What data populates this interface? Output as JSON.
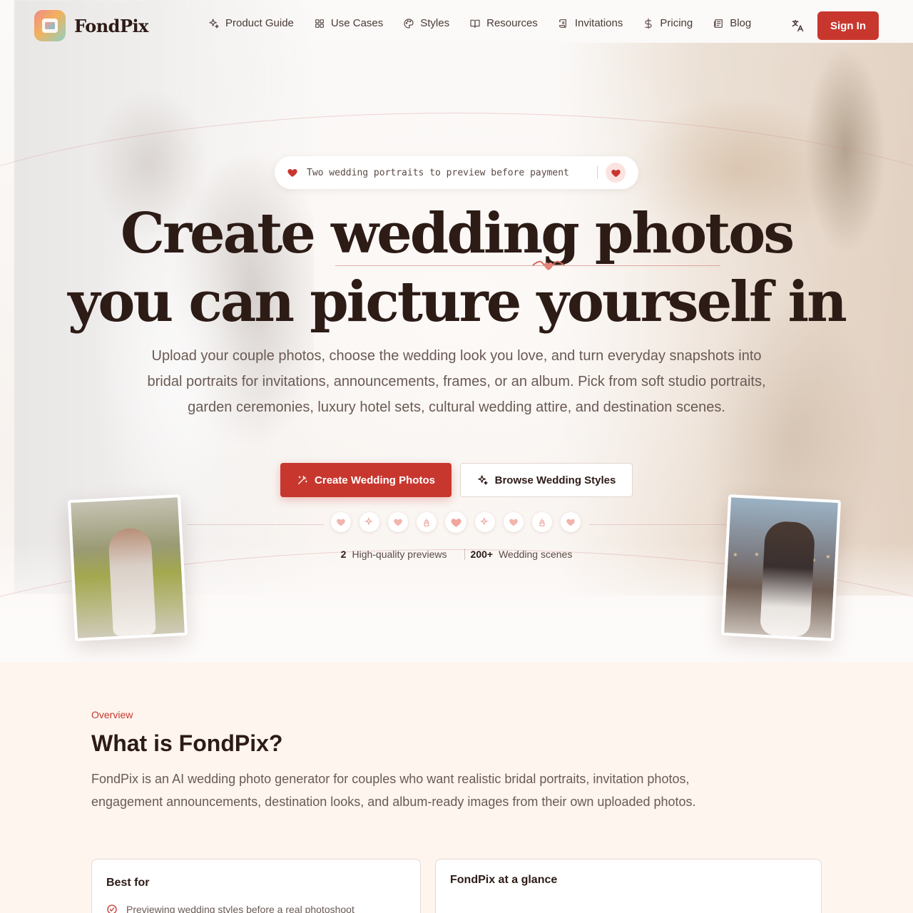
{
  "brand": {
    "name": "FondPix"
  },
  "nav": {
    "items": [
      {
        "label": "Product Guide",
        "icon": "sparkles-icon"
      },
      {
        "label": "Use Cases",
        "icon": "grid-icon"
      },
      {
        "label": "Styles",
        "icon": "palette-icon"
      },
      {
        "label": "Resources",
        "icon": "book-open-icon"
      },
      {
        "label": "Invitations",
        "icon": "scroll-icon"
      },
      {
        "label": "Pricing",
        "icon": "dollar-icon"
      },
      {
        "label": "Blog",
        "icon": "newspaper-icon"
      }
    ],
    "language_icon": "translate-icon",
    "sign_in": "Sign In"
  },
  "hero": {
    "pill_text": "Two wedding portraits to preview before payment",
    "headline_line1": "Create wedding photos",
    "headline_line2": "you can picture yourself in",
    "subtext": "Upload your couple photos, choose the wedding look you love, and turn everyday snapshots into bridal portraits for invitations, announcements, frames, or an album. Pick from soft studio portraits, garden ceremonies, luxury hotel sets, cultural wedding attire, and destination scenes.",
    "cta_primary": "Create Wedding Photos",
    "cta_secondary": "Browse Wedding Styles",
    "icon_row": [
      "heart-icon",
      "sparkles-icon",
      "heart-icon",
      "cake-icon",
      "heart-icon",
      "sparkles-icon",
      "heart-icon",
      "cake-icon",
      "heart-icon"
    ],
    "stats": [
      {
        "value": "2",
        "label": "High-quality previews"
      },
      {
        "value": "200+",
        "label": "Wedding scenes"
      }
    ]
  },
  "overview": {
    "eyebrow": "Overview",
    "title": "What is FondPix?",
    "text": "FondPix is an AI wedding photo generator for couples who want realistic bridal portraits, invitation photos, engagement announcements, destination looks, and album-ready images from their own uploaded photos.",
    "best_for_title": "Best for",
    "best_for_items": [
      "Previewing wedding styles before a real photoshoot"
    ],
    "glance_title": "FondPix at a glance"
  },
  "colors": {
    "accent": "#c8372e",
    "text": "#2d1b16",
    "muted": "#6a5a54",
    "section_bg": "#fdf5ee"
  }
}
